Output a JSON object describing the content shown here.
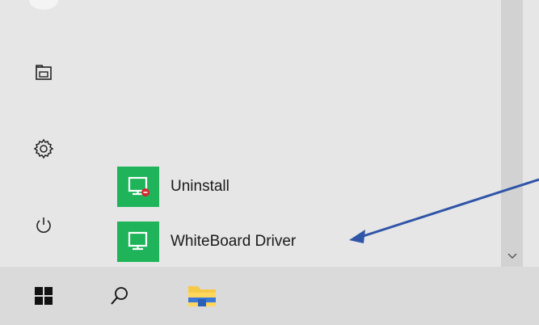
{
  "start_menu": {
    "rail": {
      "documents_icon": "folder-icon",
      "settings_icon": "gear-icon",
      "power_icon": "power-icon"
    },
    "apps": [
      {
        "label": "Uninstall",
        "icon": "app-uninstall-icon"
      },
      {
        "label": "WhiteBoard Driver",
        "icon": "app-whiteboard-icon"
      }
    ]
  },
  "taskbar": {
    "start_icon": "windows-logo-icon",
    "search_icon": "search-icon",
    "explorer_icon": "file-explorer-icon"
  },
  "colors": {
    "menu_bg": "#e6e6e6",
    "taskbar_bg": "#dadada",
    "app_tile": "#1fb45a",
    "arrow": "#2f54a8"
  }
}
